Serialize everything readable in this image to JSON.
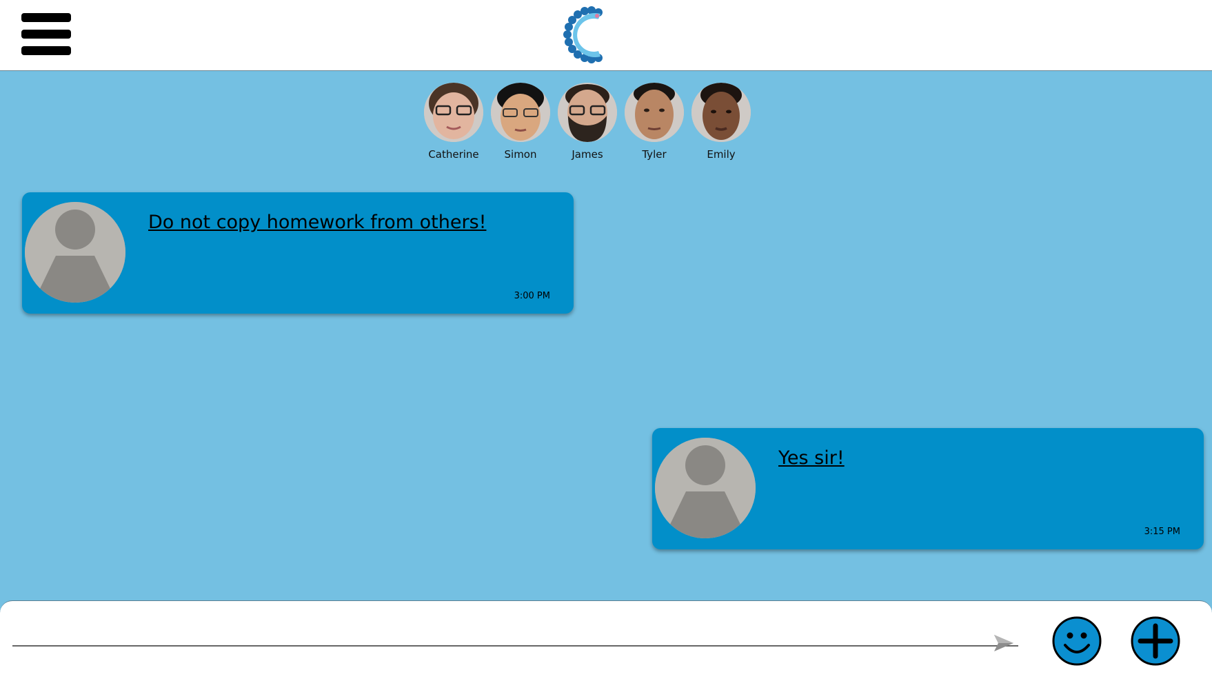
{
  "header": {
    "menu_icon": "hamburger-menu-icon",
    "logo": "classroom-chat-logo"
  },
  "members": [
    {
      "name": "Catherine"
    },
    {
      "name": "Simon"
    },
    {
      "name": "James"
    },
    {
      "name": "Tyler"
    },
    {
      "name": "Emily"
    }
  ],
  "messages": [
    {
      "text": "Do not copy homework from others!",
      "time": "3:00 PM"
    },
    {
      "text": "Yes sir!",
      "time": "3:15 PM"
    }
  ],
  "composer": {
    "value": "",
    "placeholder": "",
    "send_icon": "send-icon",
    "emoji_icon": "smiley-icon",
    "add_icon": "plus-icon"
  },
  "colors": {
    "background": "#74c0e2",
    "bubble": "#028fc9",
    "topbar": "#ffffff",
    "button_fill": "#0b8fd0"
  }
}
